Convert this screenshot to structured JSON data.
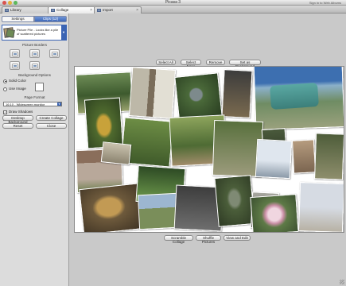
{
  "window": {
    "title": "Picasa 3",
    "signin": "Sign in to Web Albums"
  },
  "tabs": [
    {
      "label": "Library"
    },
    {
      "label": "Collage"
    },
    {
      "label": "Import"
    }
  ],
  "panel": {
    "subtabs": {
      "settings": "Settings",
      "clips": "Clips (12)"
    },
    "style_text": "Picture Pile - Looks like a pile of scattered pictures",
    "picture_borders_label": "Picture Borders",
    "background_label": "Background Options",
    "solid_color_label": "Solid Color",
    "use_image_label": "Use Image",
    "page_format_label": "Page Format",
    "page_format_value": "16:10 - Widescreen monitor",
    "draw_shadows_label": "Draw Shadows",
    "show_captions_label": "Show Captions",
    "buttons": {
      "desktop_background": "Desktop Background",
      "create_collage": "Create Collage",
      "reset": "Reset",
      "close": "Close"
    }
  },
  "toolbar": {
    "select_all": "Select All",
    "select_none": "Select None",
    "remove": "Remove",
    "set_as_background": "Set as Background"
  },
  "bottombar": {
    "scramble_collage": "Scramble Collage",
    "shuffle_pictures": "Shuffle Pictures",
    "view_and_edit": "View and Edit"
  },
  "colors": {
    "accent": "#3a64b4",
    "panel_bg": "#dcdcdc",
    "workspace_bg": "#c9c9c9",
    "canvas_bg": "#ffffff"
  }
}
